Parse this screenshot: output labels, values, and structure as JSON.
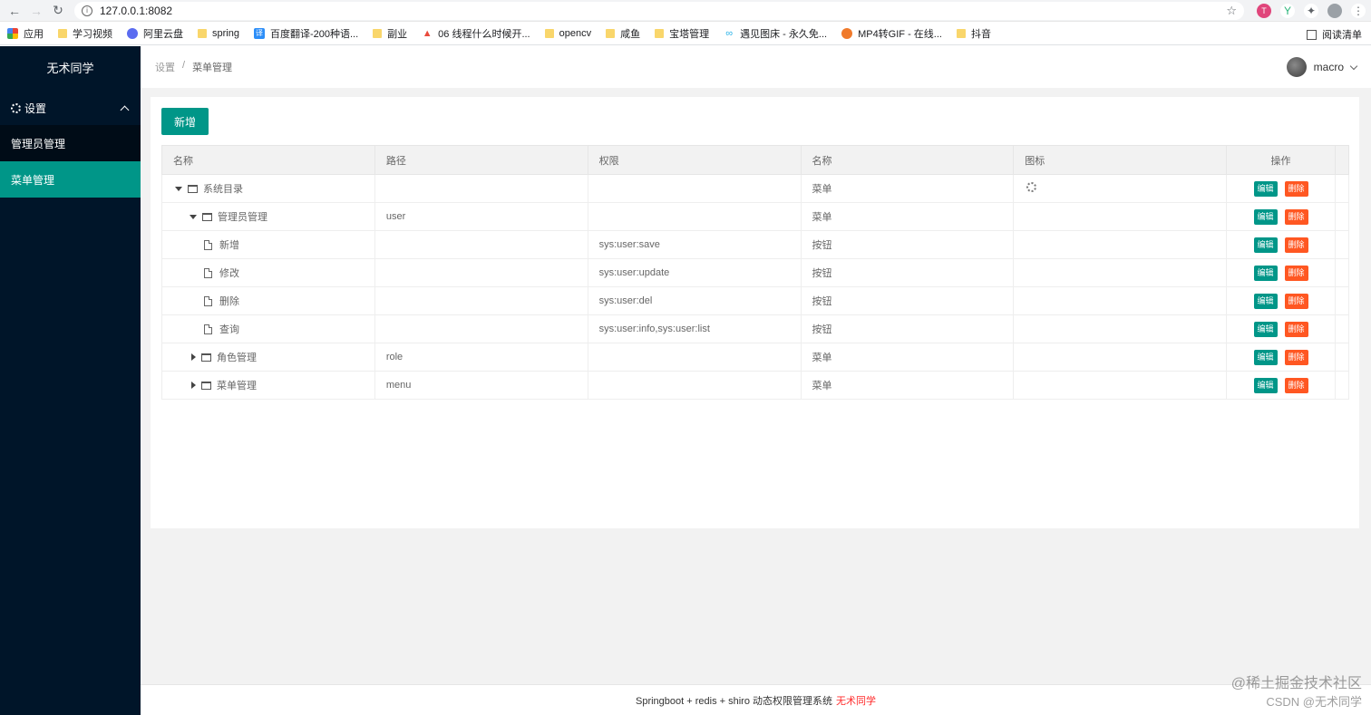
{
  "browser": {
    "url": "127.0.0.1:8082",
    "bookmarks": [
      {
        "label": "应用",
        "icon": "apps-icon"
      },
      {
        "label": "学习视频",
        "icon": "folder-icon"
      },
      {
        "label": "阿里云盘",
        "icon": "aliyun-icon"
      },
      {
        "label": "spring",
        "icon": "folder-icon"
      },
      {
        "label": "百度翻译-200种语...",
        "icon": "translate-icon"
      },
      {
        "label": "副业",
        "icon": "folder-icon"
      },
      {
        "label": "06 线程什么时候开...",
        "icon": "fire-icon"
      },
      {
        "label": "opencv",
        "icon": "folder-icon"
      },
      {
        "label": "咸鱼",
        "icon": "folder-icon"
      },
      {
        "label": "宝塔管理",
        "icon": "folder-icon"
      },
      {
        "label": "遇见图床 - 永久免...",
        "icon": "link-icon"
      },
      {
        "label": "MP4转GIF - 在线...",
        "icon": "convert-icon"
      },
      {
        "label": "抖音",
        "icon": "folder-icon"
      }
    ],
    "reading_list": "阅读清单"
  },
  "sidebar": {
    "logo": "无术同学",
    "group": "设置",
    "items": [
      {
        "label": "管理员管理"
      },
      {
        "label": "菜单管理"
      }
    ]
  },
  "header": {
    "breadcrumb": [
      "设置",
      "/",
      "菜单管理"
    ],
    "username": "macro"
  },
  "toolbar": {
    "add_label": "新增"
  },
  "table": {
    "columns": [
      "名称",
      "路径",
      "权限",
      "名称",
      "图标",
      "操作"
    ],
    "edit_label": "编辑",
    "delete_label": "删除",
    "rows": [
      {
        "name": "系统目录",
        "path": "",
        "perm": "",
        "type": "菜单",
        "icon": "gear-icon"
      },
      {
        "name": "管理员管理",
        "path": "user",
        "perm": "",
        "type": "菜单",
        "icon": ""
      },
      {
        "name": "新增",
        "path": "",
        "perm": "sys:user:save",
        "type": "按钮",
        "icon": ""
      },
      {
        "name": "修改",
        "path": "",
        "perm": "sys:user:update",
        "type": "按钮",
        "icon": ""
      },
      {
        "name": "删除",
        "path": "",
        "perm": "sys:user:del",
        "type": "按钮",
        "icon": ""
      },
      {
        "name": "查询",
        "path": "",
        "perm": "sys:user:info,sys:user:list",
        "type": "按钮",
        "icon": ""
      },
      {
        "name": "角色管理",
        "path": "role",
        "perm": "",
        "type": "菜单",
        "icon": ""
      },
      {
        "name": "菜单管理",
        "path": "menu",
        "perm": "",
        "type": "菜单",
        "icon": ""
      }
    ]
  },
  "footer": {
    "text": "Springboot + redis + shiro 动态权限管理系统",
    "author": "无术同学"
  },
  "watermark": {
    "line1": "@稀土掘金技术社区",
    "line2": "CSDN @无术同学"
  },
  "colors": {
    "sidebar_bg": "#001529",
    "accent": "#009688",
    "danger": "#ff5722"
  }
}
